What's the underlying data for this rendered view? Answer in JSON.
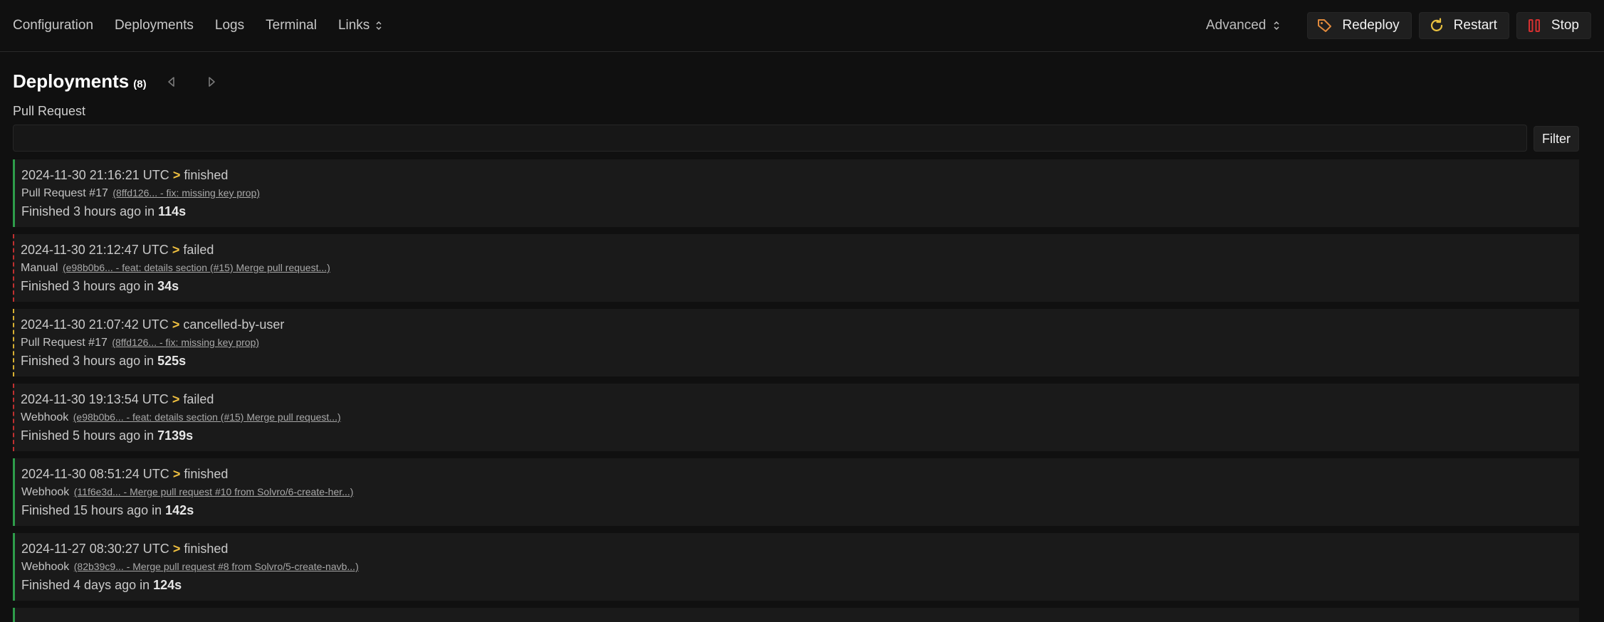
{
  "nav": {
    "items": [
      "Configuration",
      "Deployments",
      "Logs",
      "Terminal"
    ],
    "links_label": "Links",
    "advanced_label": "Advanced",
    "redeploy_label": "Redeploy",
    "restart_label": "Restart",
    "stop_label": "Stop"
  },
  "colors": {
    "finished": "#2e9c4a",
    "failed": "#c03030",
    "cancelled": "#d8b032",
    "arrow": "#f0c040",
    "redeploy_icon": "#e08a3c",
    "restart_icon": "#e8c040",
    "stop_icon": "#d43030"
  },
  "page": {
    "title": "Deployments",
    "count": "(8)"
  },
  "filter": {
    "label": "Pull Request",
    "value": "",
    "button": "Filter"
  },
  "deployments": [
    {
      "timestamp": "2024-11-30 21:16:21 UTC",
      "status": "finished",
      "trigger": "Pull Request #17",
      "commit": "(8ffd126... - fix: missing key prop)",
      "finished_prefix": "Finished 3 hours ago in",
      "duration": "114s"
    },
    {
      "timestamp": "2024-11-30 21:12:47 UTC",
      "status": "failed",
      "trigger": "Manual",
      "commit": "(e98b0b6... - feat: details section (#15) Merge pull request...)",
      "finished_prefix": "Finished 3 hours ago in",
      "duration": "34s"
    },
    {
      "timestamp": "2024-11-30 21:07:42 UTC",
      "status": "cancelled-by-user",
      "trigger": "Pull Request #17",
      "commit": "(8ffd126... - fix: missing key prop)",
      "finished_prefix": "Finished 3 hours ago in",
      "duration": "525s"
    },
    {
      "timestamp": "2024-11-30 19:13:54 UTC",
      "status": "failed",
      "trigger": "Webhook",
      "commit": "(e98b0b6... - feat: details section (#15) Merge pull request...)",
      "finished_prefix": "Finished 5 hours ago in",
      "duration": "7139s"
    },
    {
      "timestamp": "2024-11-30 08:51:24 UTC",
      "status": "finished",
      "trigger": "Webhook",
      "commit": "(11f6e3d... - Merge pull request #10 from Solvro/6-create-her...)",
      "finished_prefix": "Finished 15 hours ago in",
      "duration": "142s"
    },
    {
      "timestamp": "2024-11-27 08:30:27 UTC",
      "status": "finished",
      "trigger": "Webhook",
      "commit": "(82b39c9... - Merge pull request #8 from Solvro/5-create-navb...)",
      "finished_prefix": "Finished 4 days ago in",
      "duration": "124s"
    }
  ]
}
